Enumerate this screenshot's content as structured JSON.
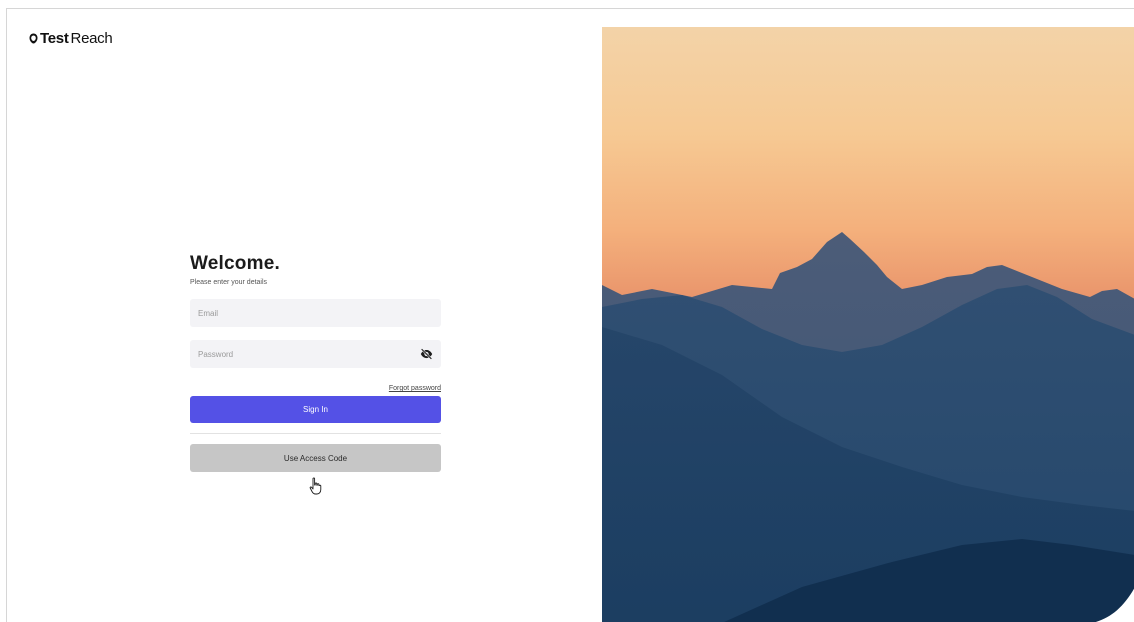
{
  "brand": {
    "name_bold": "Test",
    "name_light": "Reach",
    "logo_icon": "testreach-logo-icon"
  },
  "login": {
    "title": "Welcome.",
    "subtitle": "Please enter your details",
    "email": {
      "placeholder": "Email",
      "value": ""
    },
    "password": {
      "placeholder": "Password",
      "value": "",
      "toggle_icon": "eye-slash-icon"
    },
    "forgot_password": "Forgot password",
    "sign_in": "Sign In",
    "access_code": "Use Access Code"
  },
  "hero": {
    "image": "mountain-sunset-landscape",
    "colors": {
      "sky_top": "#f4cfa0",
      "sky_mid": "#f2a56d",
      "sky_low": "#c98e7a",
      "far_ridge": "#3f5676",
      "mid_ridge": "#2b4a6b",
      "near_ridge": "#1a3a5c"
    }
  },
  "colors": {
    "primary": "#5451e6",
    "field_bg": "#f3f3f6",
    "secondary_button": "#c6c6c6"
  }
}
